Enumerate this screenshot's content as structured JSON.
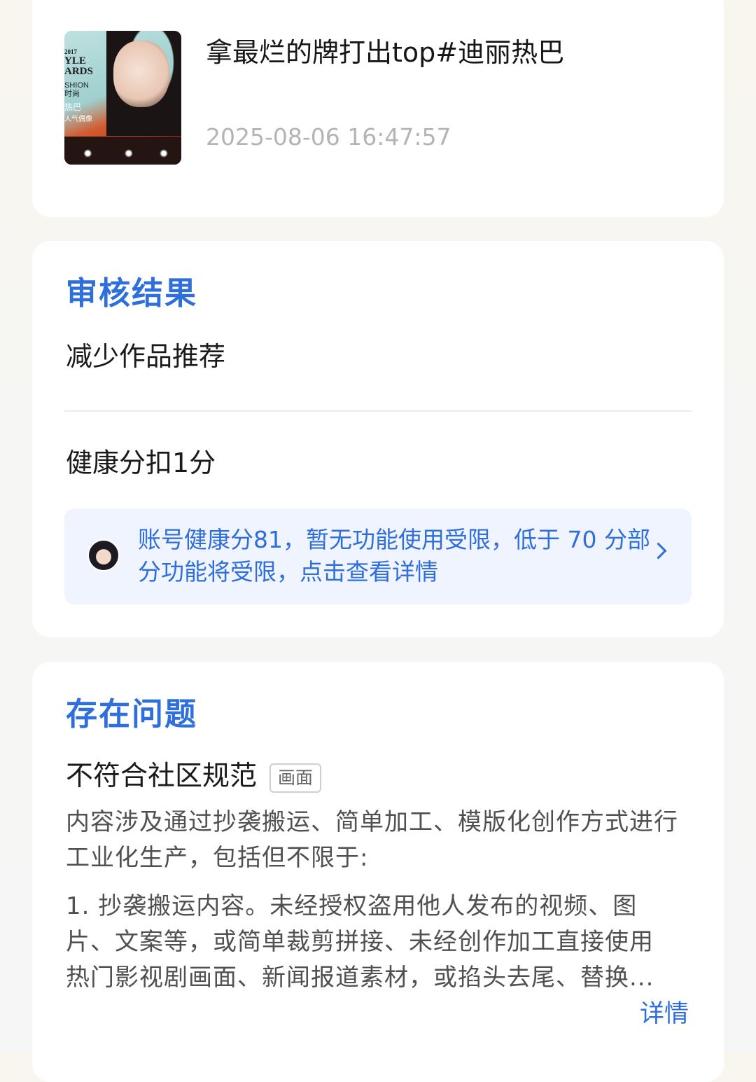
{
  "video": {
    "thumbnail_text": [
      "2017",
      "YLE",
      "ARDS",
      "SHION",
      "时尚",
      "热巴",
      "人气偶像"
    ],
    "title": "拿最烂的牌打出top#迪丽热巴",
    "timestamp": "2025-08-06 16:47:57"
  },
  "review": {
    "section_title": "审核结果",
    "result": "减少作品推荐",
    "penalty": "健康分扣1分",
    "notice_text": "账号健康分81，暂无功能使用受限，低于 70 分部分功能将受限，点击查看详情"
  },
  "issue": {
    "section_title": "存在问题",
    "name": "不符合社区规范",
    "tag": "画面",
    "description": "内容涉及通过抄袭搬运、简单加工、模版化创作方式进行工业化生产，包括但不限于:",
    "detail": "1. 抄袭搬运内容。未经授权盗用他人发布的视频、图片、文案等，或简单裁剪拼接、未经创作加工直接使用热门影视剧画面、新闻报道素材，或掐头去尾、替换...",
    "more_label": "详情"
  },
  "colors": {
    "accent": "#2f6fdc",
    "notice_bg": "#eff4ff",
    "muted_text": "#b4b4b4"
  }
}
